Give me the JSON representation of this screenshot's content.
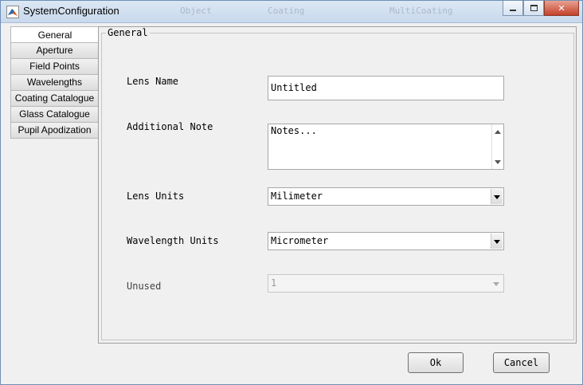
{
  "window": {
    "title": "SystemConfiguration",
    "background_hint": [
      "Object",
      "Coating",
      "MultiCoating"
    ]
  },
  "tabs": [
    {
      "label": "General",
      "active": true
    },
    {
      "label": "Aperture",
      "active": false
    },
    {
      "label": "Field Points",
      "active": false
    },
    {
      "label": "Wavelengths",
      "active": false
    },
    {
      "label": "Coating Catalogue",
      "active": false
    },
    {
      "label": "Glass Catalogue",
      "active": false
    },
    {
      "label": "Pupil Apodization",
      "active": false
    }
  ],
  "general": {
    "group_title": "General",
    "lens_name_label": "Lens Name",
    "lens_name_value": "Untitled",
    "additional_note_label": "Additional Note",
    "additional_note_value": "Notes...",
    "lens_units_label": "Lens Units",
    "lens_units_value": "Milimeter",
    "wavelength_units_label": "Wavelength Units",
    "wavelength_units_value": "Micrometer",
    "unused_label": "Unused",
    "unused_value": "1"
  },
  "buttons": {
    "ok": "Ok",
    "cancel": "Cancel"
  },
  "colors": {
    "titlebar": "#c9d9ec",
    "close_button": "#c4412a",
    "window_bg": "#f0f0f0"
  }
}
